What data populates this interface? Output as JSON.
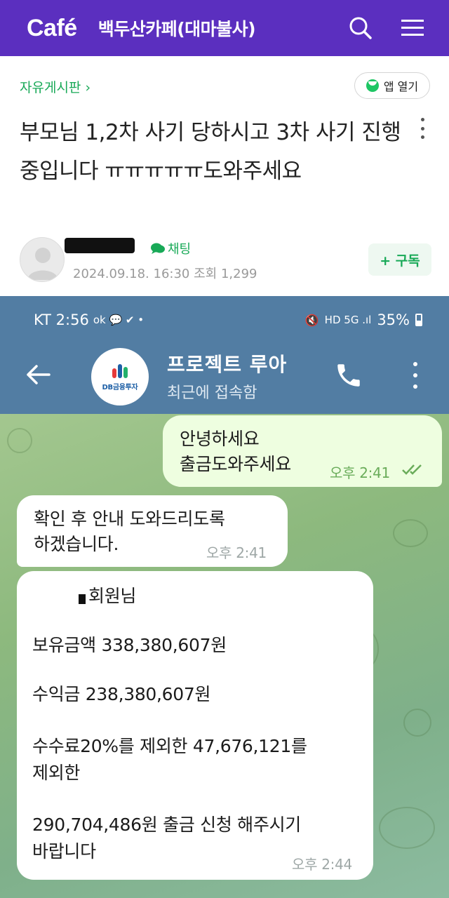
{
  "cafe": {
    "logo": "Café",
    "name": "백두산카페(대마불사)",
    "icons": [
      "search-icon",
      "menu-icon"
    ],
    "accent": "#5b2fbf"
  },
  "post": {
    "board": "자유게시판 ›",
    "open_app": "앱 열기",
    "title": "부모님 1,2차 사기 당하시고 3차 사기 진행중입니다 ㅠㅠㅠㅠㅠ도와주세요",
    "chat": "채팅",
    "meta": "2024.09.18. 16:30  조회 1,299",
    "subscribe": "+ 구독",
    "green": "#18a957"
  },
  "telegram": {
    "status_left": "KT 2:56",
    "status_right": "35%",
    "avatar_text": "DB금융투자",
    "name": "프로젝트 루아",
    "last_seen": "최근에 접속함",
    "header_color": "#527da3",
    "messages": [
      {
        "dir": "out",
        "lines": [
          "안녕하세요",
          "출금도와주세요"
        ],
        "time": "오후 2:41"
      },
      {
        "dir": "in",
        "lines": [
          "확인 후 안내 도와드리도록",
          "하겠습니다."
        ],
        "time": "오후 2:41"
      },
      {
        "dir": "in",
        "lines": [
          "회원님",
          "보유금액 338,380,607원",
          "수익금 238,380,607원",
          "수수료20%를 제외한 47,676,121를",
          "제외한",
          "290,704,486원 출금 신청 해주시기",
          "바랍니다"
        ],
        "time": "오후 2:44"
      }
    ]
  }
}
